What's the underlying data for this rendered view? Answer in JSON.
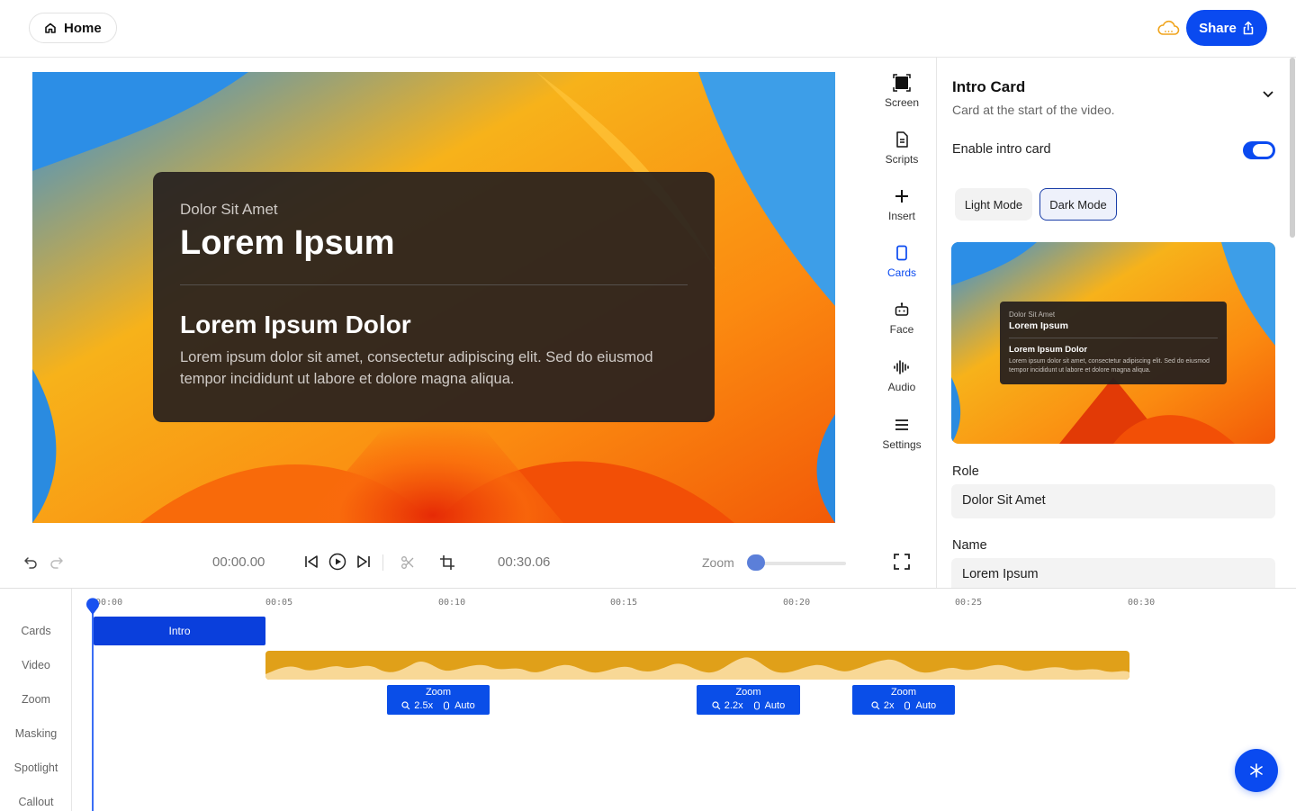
{
  "header": {
    "home_label": "Home",
    "share_label": "Share"
  },
  "preview_card": {
    "role": "Dolor Sit Amet",
    "name": "Lorem Ipsum",
    "heading": "Lorem Ipsum Dolor",
    "body": "Lorem ipsum dolor sit amet, consectetur adipiscing elit. Sed do eiusmod tempor incididunt ut labore et dolore magna aliqua."
  },
  "tools": [
    {
      "label": "Screen",
      "icon": "screen-icon"
    },
    {
      "label": "Scripts",
      "icon": "document-icon"
    },
    {
      "label": "Insert",
      "icon": "plus-icon"
    },
    {
      "label": "Cards",
      "icon": "card-icon",
      "active": true
    },
    {
      "label": "Face",
      "icon": "robot-face-icon"
    },
    {
      "label": "Audio",
      "icon": "waveform-icon"
    },
    {
      "label": "Settings",
      "icon": "menu-lines-icon"
    }
  ],
  "panel": {
    "title": "Intro Card",
    "subtitle": "Card at the start of the video.",
    "enable_label": "Enable intro card",
    "enabled": true,
    "light_mode": "Light Mode",
    "dark_mode": "Dark Mode",
    "selected_mode": "Dark Mode",
    "role_label": "Role",
    "role_value": "Dolor Sit Amet",
    "name_label": "Name",
    "name_value": "Lorem Ipsum"
  },
  "playback": {
    "current_time": "00:00.00",
    "total_time": "00:30.06",
    "zoom_label": "Zoom"
  },
  "timeline": {
    "ticks": [
      "00:00",
      "00:05",
      "00:10",
      "00:15",
      "00:20",
      "00:25",
      "00:30"
    ],
    "tracks": [
      "Cards",
      "Video",
      "Zoom",
      "Masking",
      "Spotlight",
      "Callout"
    ],
    "intro_clip": "Intro",
    "zoom_clips": [
      {
        "title": "Zoom",
        "level": "2.5x",
        "mode": "Auto"
      },
      {
        "title": "Zoom",
        "level": "2.2x",
        "mode": "Auto"
      },
      {
        "title": "Zoom",
        "level": "2x",
        "mode": "Auto"
      }
    ]
  },
  "colors": {
    "accent": "#0a4af0",
    "video_clip": "#e0a019"
  }
}
